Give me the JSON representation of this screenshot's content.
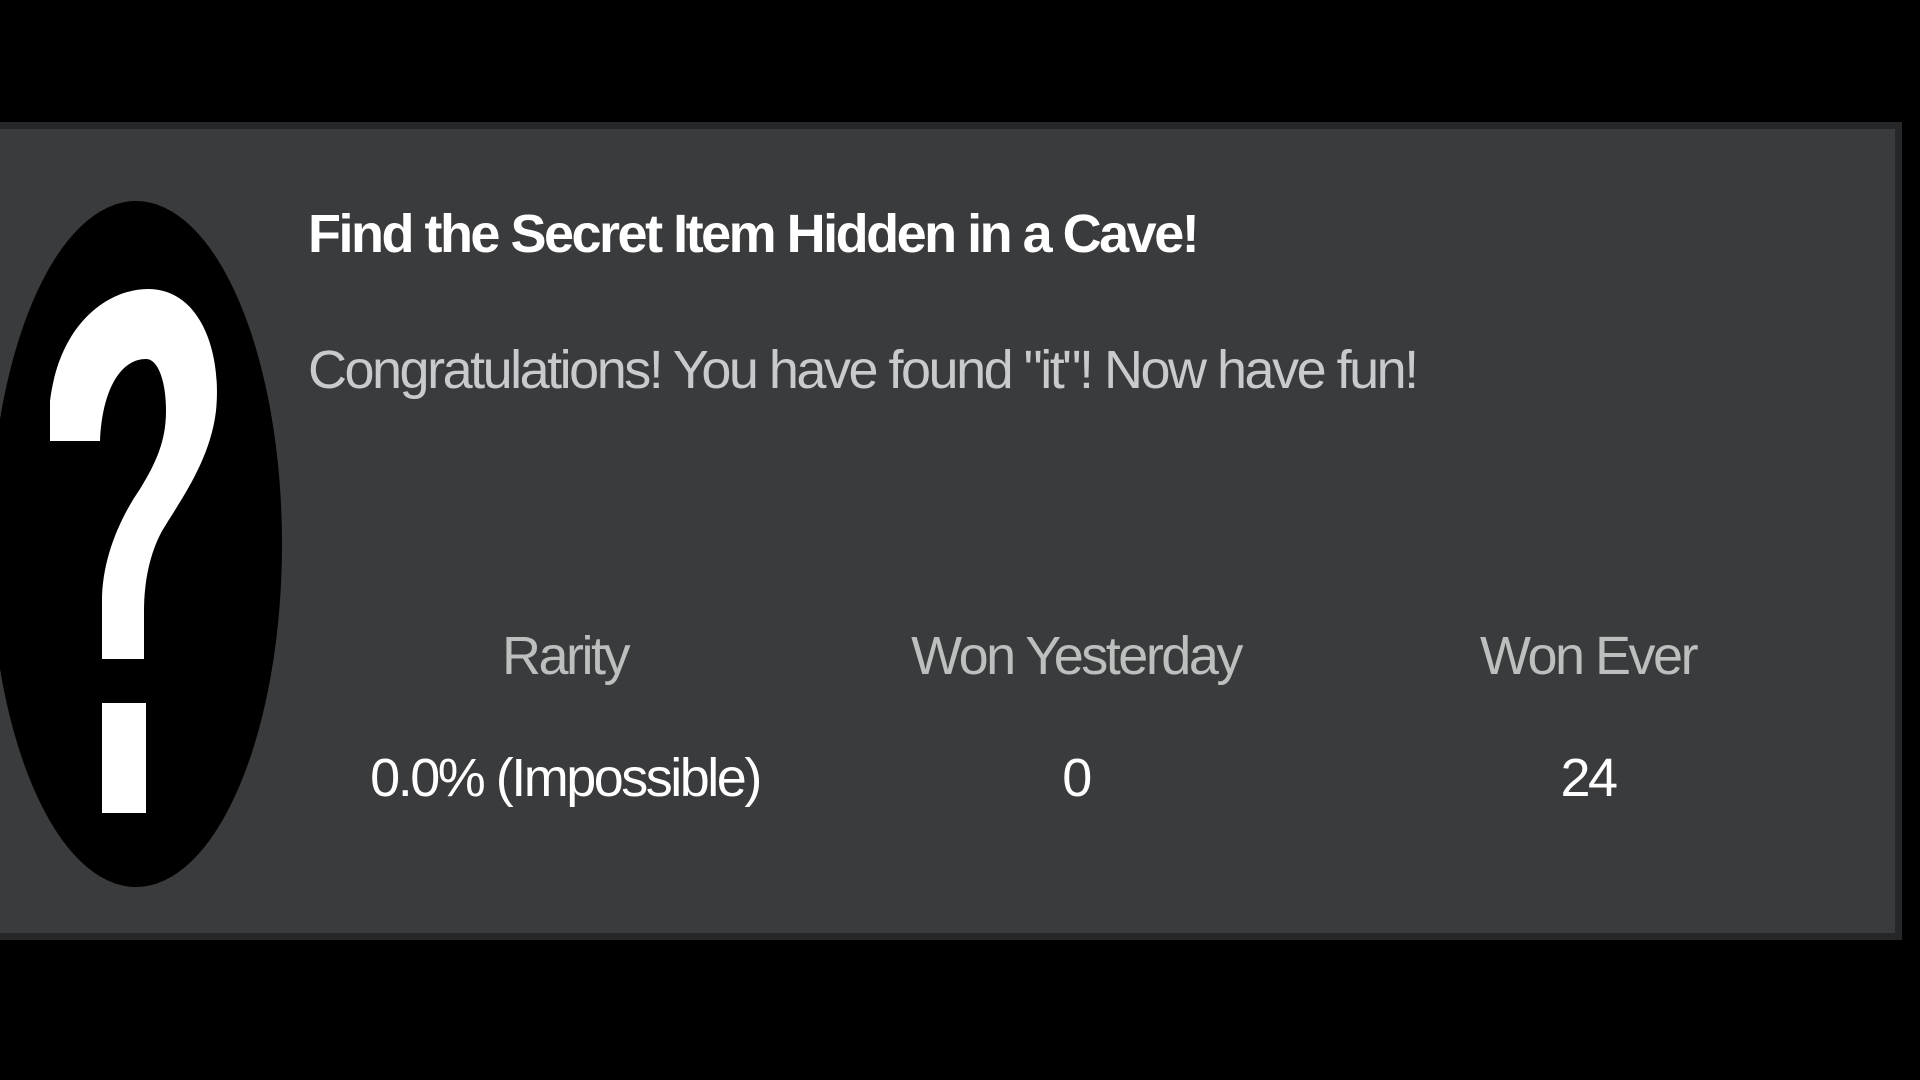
{
  "badge": {
    "icon": "question-mark-icon",
    "title": "Find the Secret Item Hidden in a Cave!",
    "description": "Congratulations! You have found \"it\"! Now have fun!"
  },
  "stats": {
    "rarity": {
      "label": "Rarity",
      "value": "0.0% (Impossible)"
    },
    "won_yesterday": {
      "label": "Won Yesterday",
      "value": "0"
    },
    "won_ever": {
      "label": "Won Ever",
      "value": "24"
    }
  },
  "colors": {
    "page_background": "#000000",
    "card_background": "#393b3d",
    "card_border": "#262729",
    "title_text": "#ffffff",
    "description_text": "#c9cacb",
    "label_text": "#bdbebe",
    "value_text": "#ffffff"
  }
}
